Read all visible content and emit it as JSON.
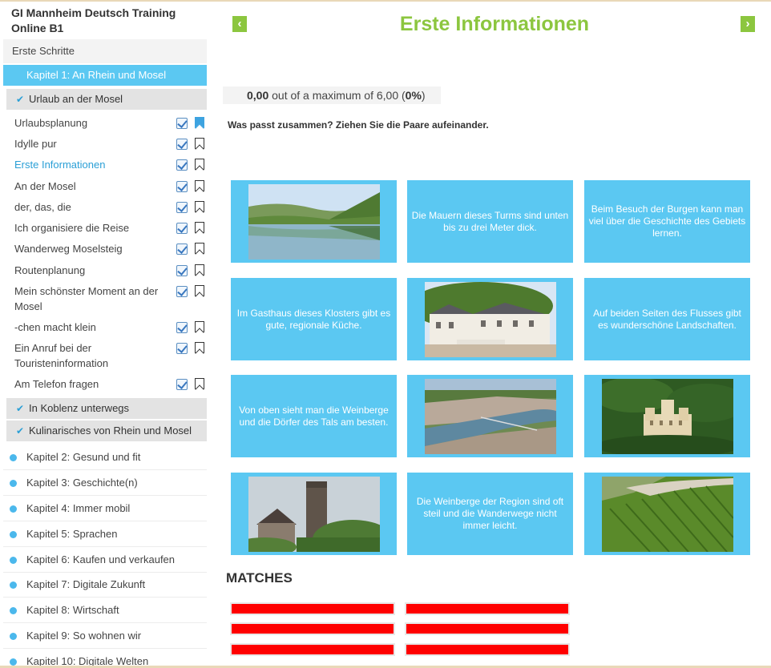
{
  "sidebar": {
    "course_title": "GI Mannheim Deutsch Training Online B1",
    "first_steps": "Erste Schritte",
    "active_chapter": "Kapitel 1: An Rhein und Mosel",
    "sections": [
      "Urlaub an der Mosel",
      "In Koblenz unterwegs",
      "Kulinarisches von Rhein und Mosel"
    ],
    "lessons": [
      "Urlaubsplanung",
      "Idylle pur",
      "Erste Informationen",
      "An der Mosel",
      "der, das, die",
      "Ich organisiere die Reise",
      "Wanderweg Moselsteig",
      "Routenplanung",
      "Mein schönster Moment an der Mosel",
      "-chen macht klein",
      "Ein Anruf bei der Touristeninformation",
      "Am Telefon fragen"
    ],
    "chapters": [
      "Kapitel 2: Gesund und fit",
      "Kapitel 3: Geschichte(n)",
      "Kapitel 4: Immer mobil",
      "Kapitel 5: Sprachen",
      "Kapitel 6: Kaufen und verkaufen",
      "Kapitel 7: Digitale Zukunft",
      "Kapitel 8: Wirtschaft",
      "Kapitel 9: So wohnen wir",
      "Kapitel 10: Digitale Welten"
    ]
  },
  "main": {
    "title": "Erste Informationen",
    "score": {
      "points": "0,00",
      "text": " out of a maximum of 6,00 (",
      "percent": "0%",
      "close": ")"
    },
    "instruction": "Was passt zusammen? Ziehen Sie die Paare aufeinander.",
    "cards": {
      "c2": "Die Mauern dieses Turms sind unten bis zu drei Meter dick.",
      "c3": "Beim Besuch der Burgen kann man viel über die Geschichte des Gebiets lernen.",
      "c4": "Im Gasthaus dieses Klosters gibt es gute, regionale Küche.",
      "c6": "Auf beiden Seiten des Flusses gibt es wunderschöne Landschaften.",
      "c7": "Von oben sieht man die Weinberge und die Dörfer des Tals am besten.",
      "c11": "Die Weinberge der Region sind oft steil und die Wanderwege nicht immer leicht."
    },
    "matches_title": "MATCHES"
  },
  "colors": {
    "accent_green": "#8cc63f",
    "card_blue": "#5bc8f2",
    "match_red": "#ff0000"
  }
}
